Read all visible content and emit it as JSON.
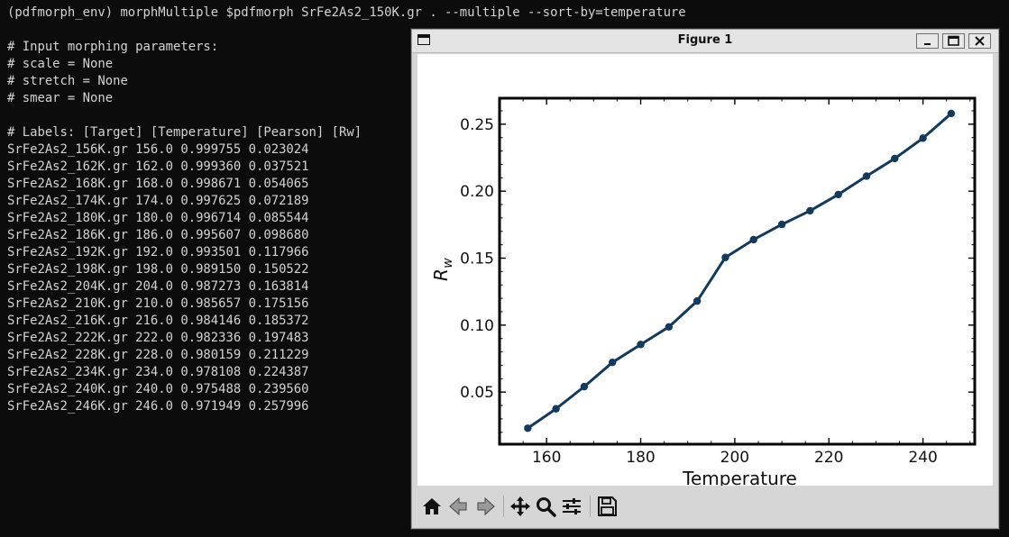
{
  "terminal": {
    "lines": [
      "(pdfmorph_env) morphMultiple $pdfmorph SrFe2As2_150K.gr . --multiple --sort-by=temperature",
      "",
      "# Input morphing parameters:",
      "# scale = None",
      "# stretch = None",
      "# smear = None",
      "",
      "# Labels: [Target] [Temperature] [Pearson] [Rw]",
      "SrFe2As2_156K.gr 156.0 0.999755 0.023024",
      "SrFe2As2_162K.gr 162.0 0.999360 0.037521",
      "SrFe2As2_168K.gr 168.0 0.998671 0.054065",
      "SrFe2As2_174K.gr 174.0 0.997625 0.072189",
      "SrFe2As2_180K.gr 180.0 0.996714 0.085544",
      "SrFe2As2_186K.gr 186.0 0.995607 0.098680",
      "SrFe2As2_192K.gr 192.0 0.993501 0.117966",
      "SrFe2As2_198K.gr 198.0 0.989150 0.150522",
      "SrFe2As2_204K.gr 204.0 0.987273 0.163814",
      "SrFe2As2_210K.gr 210.0 0.985657 0.175156",
      "SrFe2As2_216K.gr 216.0 0.984146 0.185372",
      "SrFe2As2_222K.gr 222.0 0.982336 0.197483",
      "SrFe2As2_228K.gr 228.0 0.980159 0.211229",
      "SrFe2As2_234K.gr 234.0 0.978108 0.224387",
      "SrFe2As2_240K.gr 240.0 0.975488 0.239560",
      "SrFe2As2_246K.gr 246.0 0.971949 0.257996"
    ]
  },
  "window": {
    "title": "Figure 1",
    "controls": [
      "minimize-icon",
      "maximize-icon",
      "close-icon"
    ]
  },
  "toolbar": {
    "buttons": [
      "home-icon",
      "back-arrow-icon",
      "forward-arrow-icon",
      "pan-move-icon",
      "zoom-magnifier-icon",
      "subplots-config-icon",
      "save-icon"
    ]
  },
  "chart_data": {
    "type": "line",
    "x": [
      156,
      162,
      168,
      174,
      180,
      186,
      192,
      198,
      204,
      210,
      216,
      222,
      228,
      234,
      240,
      246
    ],
    "series": [
      {
        "values": [
          0.023024,
          0.037521,
          0.054065,
          0.072189,
          0.085544,
          0.09868,
          0.117966,
          0.150522,
          0.163814,
          0.175156,
          0.185372,
          0.197483,
          0.211229,
          0.224387,
          0.23956,
          0.257996
        ],
        "color": "#133a5c",
        "marker": "circle"
      }
    ],
    "xlabel": "Temperature",
    "ylabel_main": "R",
    "ylabel_sub": "w",
    "xlim": [
      150.0,
      251.0
    ],
    "ylim": [
      0.0111,
      0.2694
    ],
    "xticks": [
      160,
      180,
      200,
      220,
      240
    ],
    "xtick_labels": [
      "160",
      "180",
      "200",
      "220",
      "240"
    ],
    "yticks": [
      0.05,
      0.1,
      0.15,
      0.2,
      0.25
    ],
    "ytick_labels": [
      "0.05",
      "0.10",
      "0.15",
      "0.20",
      "0.25"
    ],
    "grid": false,
    "legend": "none"
  }
}
